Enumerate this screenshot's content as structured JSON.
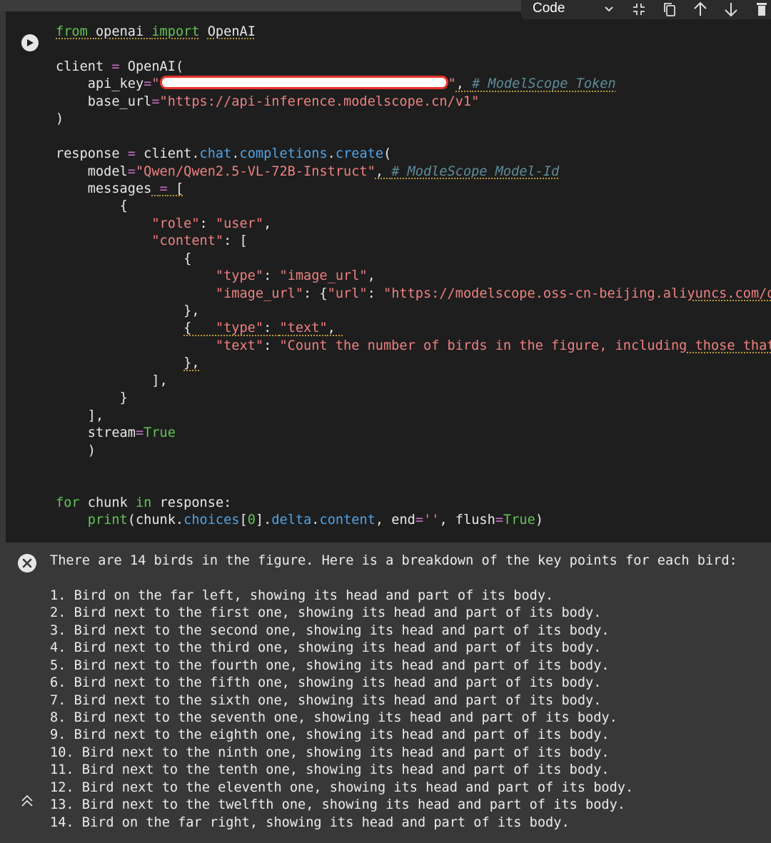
{
  "toolbar": {
    "cell_type": "Code",
    "icons": [
      "chevron-down-icon",
      "collapse-icon",
      "copy-icon",
      "move-up-icon",
      "move-down-icon",
      "delete-icon"
    ]
  },
  "code_lines": [
    "from openai import OpenAI",
    "",
    "client = OpenAI(",
    "    api_key=\"\", # ModelScope Token",
    "    base_url=\"https://api-inference.modelscope.cn/v1\"",
    ")",
    "",
    "response = client.chat.completions.create(",
    "    model=\"Qwen/Qwen2.5-VL-72B-Instruct\", # ModleScope Model-Id",
    "    messages = [",
    "        {",
    "            \"role\": \"user\",",
    "            \"content\": [",
    "                {",
    "                    \"type\": \"image_url\",",
    "                    \"image_url\": {\"url\": \"https://modelscope.oss-cn-beijing.aliyuncs.com/d",
    "                },",
    "                {   \"type\": \"text\",",
    "                    \"text\": \"Count the number of birds in the figure, including those that",
    "                },",
    "            ],",
    "        }",
    "    ],",
    "    stream=True",
    "    )",
    "",
    "",
    "for chunk in response:",
    "    print(chunk.choices[0].delta.content, end='', flush=True)"
  ],
  "output": {
    "summary": "There are 14 birds in the figure. Here is a breakdown of the key points for each bird:",
    "items": [
      "1. Bird on the far left, showing its head and part of its body.",
      "2. Bird next to the first one, showing its head and part of its body.",
      "3. Bird next to the second one, showing its head and part of its body.",
      "4. Bird next to the third one, showing its head and part of its body.",
      "5. Bird next to the fourth one, showing its head and part of its body.",
      "6. Bird next to the fifth one, showing its head and part of its body.",
      "7. Bird next to the sixth one, showing its head and part of its body.",
      "8. Bird next to the seventh one, showing its head and part of its body.",
      "9. Bird next to the eighth one, showing its head and part of its body.",
      "10. Bird next to the ninth one, showing its head and part of its body.",
      "11. Bird next to the tenth one, showing its head and part of its body.",
      "12. Bird next to the eleventh one, showing its head and part of its body.",
      "13. Bird next to the twelfth one, showing its head and part of its body.",
      "14. Bird on the far right, showing its head and part of its body."
    ]
  },
  "colors": {
    "keyword": "#61c554",
    "string": "#f08080",
    "comment": "#5f8c99",
    "attribute": "#4fa3e6",
    "operator": "#c46fc0",
    "cell_background": "#1e1e1e",
    "output_background": "#383838",
    "redaction_outline": "#e8332a"
  }
}
